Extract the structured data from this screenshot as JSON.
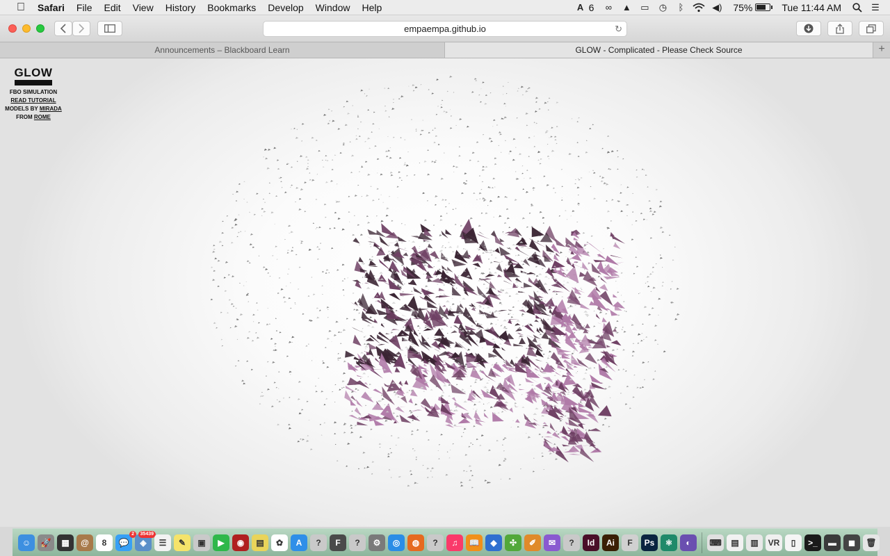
{
  "menubar": {
    "app_name": "Safari",
    "items": [
      "File",
      "Edit",
      "View",
      "History",
      "Bookmarks",
      "Develop",
      "Window",
      "Help"
    ],
    "status": {
      "adobe_count": "6",
      "battery": "75%",
      "battery_level": 0.75,
      "clock": "Tue 11:44 AM"
    }
  },
  "toolbar": {
    "url": "empaempa.github.io"
  },
  "tabs": [
    {
      "label": "Announcements – Blackboard Learn",
      "active": false
    },
    {
      "label": "GLOW - Complicated - Please Check Source",
      "active": true
    }
  ],
  "page": {
    "title": "GLOW",
    "line1": "FBO SIMULATION",
    "tutorial_link": "READ TUTORIAL",
    "models_prefix": "MODELS BY",
    "models_link": "MIRADA",
    "from_prefix": "FROM",
    "from_link": "ROME"
  },
  "scene_colors": {
    "background": "#ffffff",
    "dark_purple": "#3a2433",
    "mid_purple": "#6e3f63",
    "light_purple": "#b07aa8",
    "particle": "#555555"
  },
  "dock": [
    {
      "name": "finder",
      "color": "#3d8fe0",
      "glyph": "☺"
    },
    {
      "name": "launchpad",
      "color": "#8a8a8a",
      "glyph": "🚀"
    },
    {
      "name": "mission-control",
      "color": "#333333",
      "glyph": "▦"
    },
    {
      "name": "contacts",
      "color": "#a87a4a",
      "glyph": "@"
    },
    {
      "name": "calendar",
      "color": "#ffffff",
      "glyph": "8",
      "dark": true
    },
    {
      "name": "messages",
      "color": "#38a0f5",
      "glyph": "💬",
      "badge": "2"
    },
    {
      "name": "preview",
      "color": "#5b8fc9",
      "glyph": "◈",
      "badge": "35439"
    },
    {
      "name": "reminders",
      "color": "#f2f2f2",
      "glyph": "☰",
      "dark": true
    },
    {
      "name": "notes",
      "color": "#f5e36a",
      "glyph": "✎",
      "dark": true
    },
    {
      "name": "photo-booth",
      "color": "#c9c9c9",
      "glyph": "▣",
      "dark": true
    },
    {
      "name": "facetime",
      "color": "#2eb84a",
      "glyph": "▶"
    },
    {
      "name": "photo-app",
      "color": "#b02020",
      "glyph": "◉"
    },
    {
      "name": "stickies",
      "color": "#e9d45a",
      "glyph": "▤",
      "dark": true
    },
    {
      "name": "photos",
      "color": "#ffffff",
      "glyph": "✿",
      "dark": true
    },
    {
      "name": "app-store",
      "color": "#2f8fe8",
      "glyph": "A"
    },
    {
      "name": "unknown-app-1",
      "color": "#c9c9c9",
      "glyph": "?",
      "dark": true
    },
    {
      "name": "font-book",
      "color": "#4a4a4a",
      "glyph": "F"
    },
    {
      "name": "unknown-app-2",
      "color": "#c9c9c9",
      "glyph": "?",
      "dark": true
    },
    {
      "name": "system-preferences",
      "color": "#7a7a7a",
      "glyph": "⚙"
    },
    {
      "name": "safari",
      "color": "#2a8de6",
      "glyph": "◎"
    },
    {
      "name": "firefox",
      "color": "#e66a1f",
      "glyph": "◍"
    },
    {
      "name": "unknown-app-3",
      "color": "#c9c9c9",
      "glyph": "?",
      "dark": true
    },
    {
      "name": "itunes",
      "color": "#fa3a6a",
      "glyph": "♫"
    },
    {
      "name": "ibooks",
      "color": "#f0901a",
      "glyph": "📖"
    },
    {
      "name": "cloud-app",
      "color": "#2f6fd0",
      "glyph": "◆"
    },
    {
      "name": "network-app",
      "color": "#52a83a",
      "glyph": "✣"
    },
    {
      "name": "paint-app",
      "color": "#e08a2a",
      "glyph": "✐"
    },
    {
      "name": "mail-app",
      "color": "#8a5ad0",
      "glyph": "✉"
    },
    {
      "name": "unknown-app-4",
      "color": "#c9c9c9",
      "glyph": "?",
      "dark": true
    },
    {
      "name": "indesign",
      "color": "#4a0f28",
      "glyph": "Id"
    },
    {
      "name": "illustrator",
      "color": "#3a1f05",
      "glyph": "Ai"
    },
    {
      "name": "file-app",
      "color": "#d0d0d0",
      "glyph": "F",
      "dark": true
    },
    {
      "name": "photoshop",
      "color": "#0a2440",
      "glyph": "Ps"
    },
    {
      "name": "atom",
      "color": "#1f8a6a",
      "glyph": "⚛"
    },
    {
      "name": "github",
      "color": "#6a4fb0",
      "glyph": "◐"
    },
    {
      "name": "keyboard-viewer",
      "color": "#e0e0e0",
      "glyph": "⌨",
      "dark": true
    },
    {
      "name": "document-1",
      "color": "#f2f2f2",
      "glyph": "▤",
      "dark": true
    },
    {
      "name": "document-2",
      "color": "#e8e8e8",
      "glyph": "▥",
      "dark": true
    },
    {
      "name": "vr-app",
      "color": "#f0f0f0",
      "glyph": "VR",
      "dark": true
    },
    {
      "name": "document-3",
      "color": "#f5f5f5",
      "glyph": "▯",
      "dark": true
    },
    {
      "name": "terminal",
      "color": "#1a1a1a",
      "glyph": ">_"
    },
    {
      "name": "monitor-app",
      "color": "#3a3a3a",
      "glyph": "▬"
    },
    {
      "name": "dvd-app",
      "color": "#444444",
      "glyph": "◼"
    },
    {
      "name": "trash",
      "color": "#e6e6e6",
      "glyph": "🗑",
      "dark": true
    }
  ]
}
